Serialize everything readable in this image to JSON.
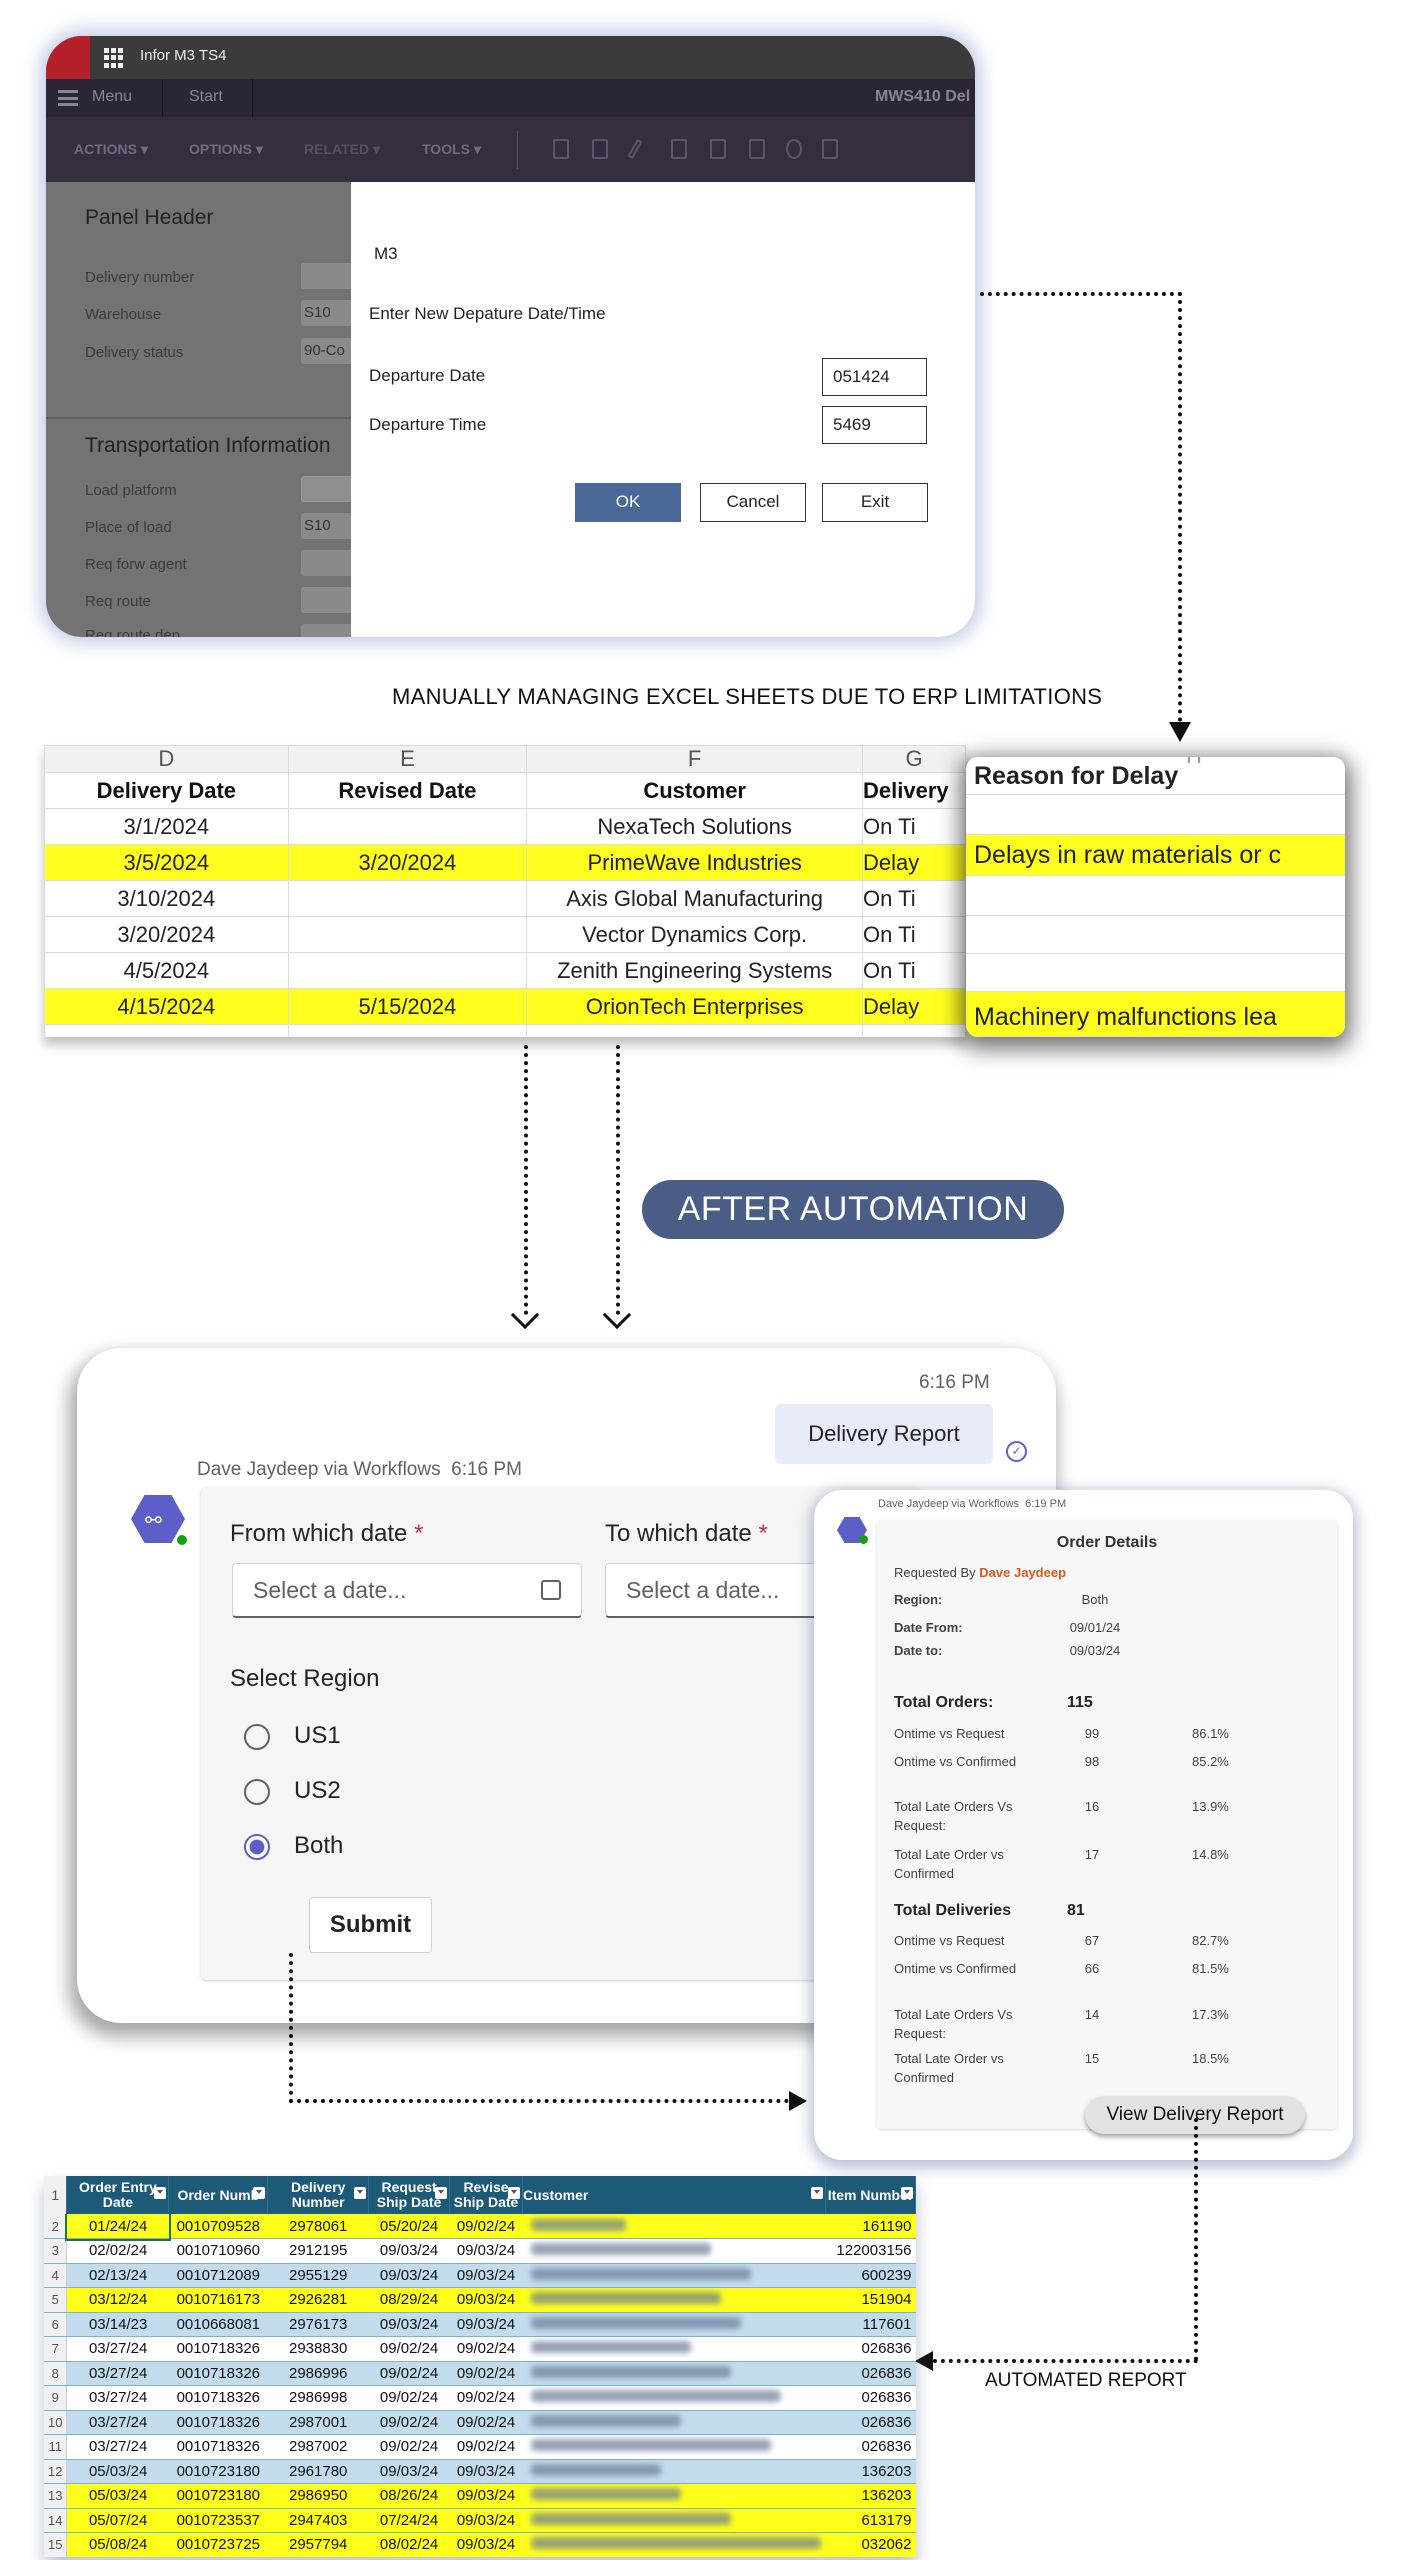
{
  "m3": {
    "app_title": "Infor M3 TS4",
    "menu_label": "Menu",
    "start_tab": "Start",
    "program_title": "MWS410 Del",
    "toolbar": [
      "ACTIONS ▾",
      "OPTIONS ▾",
      "RELATED ▾",
      "TOOLS ▾"
    ],
    "panel_header": "Panel Header",
    "fields": [
      {
        "label": "Delivery number",
        "value": ""
      },
      {
        "label": "Warehouse",
        "value": "S10"
      },
      {
        "label": "Delivery status",
        "value": "90-Co"
      }
    ],
    "transport_header": "Transportation Information",
    "transport_fields": [
      {
        "label": "Load platform",
        "value": ""
      },
      {
        "label": "Place of load",
        "value": "S10"
      },
      {
        "label": "Req forw agent",
        "value": ""
      },
      {
        "label": "Req route",
        "value": ""
      },
      {
        "label": "Req route dep",
        "value": ""
      }
    ],
    "dialog": {
      "title": "M3",
      "prompt": "Enter New Depature Date/Time",
      "date_label": "Departure Date",
      "date_value": "051424",
      "time_label": "Departure Time",
      "time_value": "5469",
      "ok": "OK",
      "cancel": "Cancel",
      "exit": "Exit"
    }
  },
  "caption_manual": "MANUALLY MANAGING EXCEL SHEETS  DUE TO ERP LIMITATIONS",
  "excel": {
    "column_letters": [
      "D",
      "E",
      "F",
      "G",
      "H"
    ],
    "headers": [
      "Delivery Date",
      "Revised Date",
      "Customer",
      "Delivery"
    ],
    "rows": [
      {
        "cells": [
          "3/1/2024",
          "",
          "NexaTech Solutions",
          "On Ti"
        ],
        "highlight": false
      },
      {
        "cells": [
          "3/5/2024",
          "3/20/2024",
          "PrimeWave Industries",
          "Delay"
        ],
        "highlight": true
      },
      {
        "cells": [
          "3/10/2024",
          "",
          "Axis Global Manufacturing",
          "On Ti"
        ],
        "highlight": false
      },
      {
        "cells": [
          "3/20/2024",
          "",
          "Vector Dynamics Corp.",
          "On Ti"
        ],
        "highlight": false
      },
      {
        "cells": [
          "4/5/2024",
          "",
          "Zenith Engineering Systems",
          "On Ti"
        ],
        "highlight": false
      },
      {
        "cells": [
          "4/15/2024",
          "5/15/2024",
          "OrionTech Enterprises",
          "Delay"
        ],
        "highlight": true
      }
    ],
    "highlight_color": "#ffff1f",
    "reason_popup": {
      "header": "Reason for Delay",
      "reasons": [
        "Delays in raw materials or c",
        "Machinery malfunctions lea"
      ]
    }
  },
  "after_automation": "AFTER AUTOMATION",
  "teams": {
    "sent_time": "6:16 PM",
    "sent_message": "Delivery Report",
    "sender_line": "Dave Jaydeep via Workflows  6:16 PM",
    "from_label": "From which date",
    "to_label": "To which date",
    "required_mark": "*",
    "date_placeholder": "Select a date...",
    "region_label": "Select Region",
    "regions": [
      "US1",
      "US2",
      "Both"
    ],
    "selected_region": "Both",
    "submit": "Submit",
    "accent": "#5b5fc7"
  },
  "order_details": {
    "sender_line": "Dave Jaydeep via Workflows  6:19 PM",
    "title": "Order Details",
    "requested_by_label": "Requested By",
    "requested_by": "Dave Jaydeep",
    "region_label": "Region:",
    "region": "Both",
    "date_from_label": "Date From:",
    "date_from": "09/01/24",
    "date_to_label": "Date to:",
    "date_to": "09/03/24",
    "orders": {
      "label": "Total Orders:",
      "total": "115",
      "rows": [
        {
          "label": "Ontime vs Request",
          "count": "99",
          "pct": "86.1%"
        },
        {
          "label": "Ontime vs Confirmed",
          "count": "98",
          "pct": "85.2%"
        },
        {
          "label": "Total Late Orders Vs Request:",
          "count": "16",
          "pct": "13.9%"
        },
        {
          "label": "Total Late Order vs Confirmed",
          "count": "17",
          "pct": "14.8%"
        }
      ]
    },
    "deliveries": {
      "label": "Total Deliveries",
      "total": "81",
      "rows": [
        {
          "label": "Ontime vs Request",
          "count": "67",
          "pct": "82.7%"
        },
        {
          "label": "Ontime vs Confirmed",
          "count": "66",
          "pct": "81.5%"
        },
        {
          "label": "Total Late Orders Vs Request:",
          "count": "14",
          "pct": "17.3%"
        },
        {
          "label": "Total Late Order vs Confirmed",
          "count": "15",
          "pct": "18.5%"
        }
      ]
    },
    "view_button": "View Delivery Report",
    "accent": "#e0561b"
  },
  "caption_automated": "AUTOMATED REPORT",
  "report": {
    "headers": [
      "Order Entry Date",
      "Order Numb",
      "Delivery Number",
      "Request Ship Date",
      "Revise Ship Date",
      "Customer",
      "Item Number"
    ],
    "header_color": "#1d5a78",
    "rows": [
      {
        "n": "2",
        "style": "yellow",
        "cells": [
          "01/24/24",
          "0010709528",
          "2978061",
          "05/20/24",
          "09/02/24",
          "",
          "161190"
        ]
      },
      {
        "n": "3",
        "style": "white",
        "cells": [
          "02/02/24",
          "0010710960",
          "2912195",
          "09/03/24",
          "09/03/24",
          "",
          "122003156"
        ]
      },
      {
        "n": "4",
        "style": "blue",
        "cells": [
          "02/13/24",
          "0010712089",
          "2955129",
          "09/03/24",
          "09/03/24",
          "",
          "600239"
        ]
      },
      {
        "n": "5",
        "style": "yellow",
        "cells": [
          "03/12/24",
          "0010716173",
          "2926281",
          "08/29/24",
          "09/03/24",
          "",
          "151904"
        ]
      },
      {
        "n": "6",
        "style": "blue",
        "cells": [
          "03/14/23",
          "0010668081",
          "2976173",
          "09/03/24",
          "09/03/24",
          "",
          "117601"
        ]
      },
      {
        "n": "7",
        "style": "white",
        "cells": [
          "03/27/24",
          "0010718326",
          "2938830",
          "09/02/24",
          "09/02/24",
          "",
          "026836"
        ]
      },
      {
        "n": "8",
        "style": "blue",
        "cells": [
          "03/27/24",
          "0010718326",
          "2986996",
          "09/02/24",
          "09/02/24",
          "",
          "026836"
        ]
      },
      {
        "n": "9",
        "style": "white",
        "cells": [
          "03/27/24",
          "0010718326",
          "2986998",
          "09/02/24",
          "09/02/24",
          "",
          "026836"
        ]
      },
      {
        "n": "10",
        "style": "blue",
        "cells": [
          "03/27/24",
          "0010718326",
          "2987001",
          "09/02/24",
          "09/02/24",
          "",
          "026836"
        ]
      },
      {
        "n": "11",
        "style": "white",
        "cells": [
          "03/27/24",
          "0010718326",
          "2987002",
          "09/02/24",
          "09/02/24",
          "",
          "026836"
        ]
      },
      {
        "n": "12",
        "style": "blue",
        "cells": [
          "05/03/24",
          "0010723180",
          "2961780",
          "09/03/24",
          "09/03/24",
          "",
          "136203"
        ]
      },
      {
        "n": "13",
        "style": "yellow",
        "cells": [
          "05/03/24",
          "0010723180",
          "2986950",
          "08/26/24",
          "09/03/24",
          "",
          "136203"
        ]
      },
      {
        "n": "14",
        "style": "yellow",
        "cells": [
          "05/07/24",
          "0010723537",
          "2947403",
          "07/24/24",
          "09/03/24",
          "",
          "613179"
        ]
      },
      {
        "n": "15",
        "style": "yellow",
        "cells": [
          "05/08/24",
          "0010723725",
          "2957794",
          "08/02/24",
          "09/03/24",
          "",
          "032062"
        ]
      }
    ]
  }
}
